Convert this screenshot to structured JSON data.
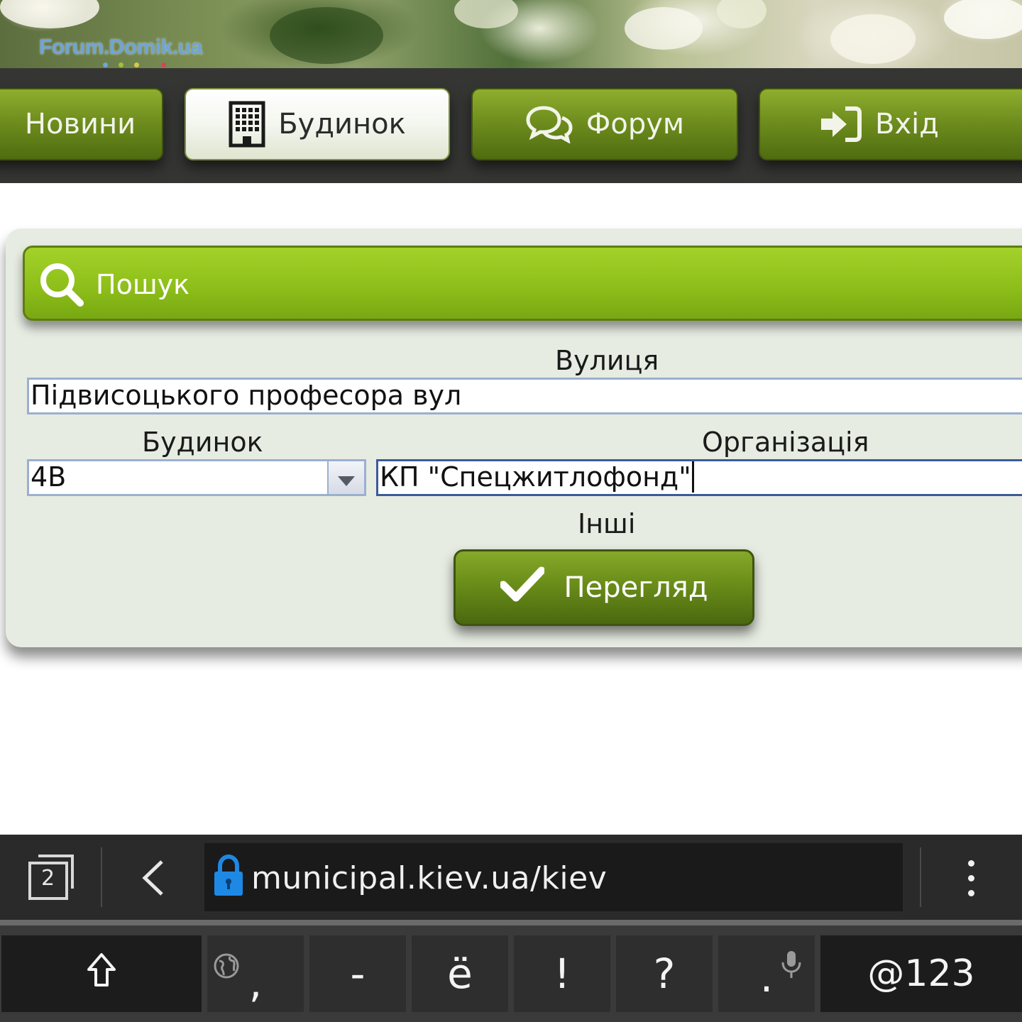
{
  "banner": {
    "logo_text": "Forum.Domik.ua"
  },
  "nav": {
    "items": [
      {
        "label": "Новини",
        "icon": "news-icon"
      },
      {
        "label": "Будинок",
        "icon": "building-icon",
        "active": true
      },
      {
        "label": "Форум",
        "icon": "chat-bubbles-icon"
      },
      {
        "label": "Вхід",
        "icon": "sign-in-icon"
      }
    ]
  },
  "search": {
    "title": "Пошук",
    "street_label": "Вулиця",
    "street_value": "Підвисоцького професора вул",
    "house_label": "Будинок",
    "house_value": "4В",
    "org_label": "Організація",
    "org_value": "КП \"Спецжитлофонд\"",
    "other_label": "Інші",
    "view_button": "Перегляд"
  },
  "browser": {
    "tab_count": "2",
    "url": "municipal.kiev.ua/kiev"
  },
  "keyboard": {
    "keys": [
      ",",
      "-",
      "ё",
      "!",
      "?",
      ".",
      "@123"
    ]
  },
  "colors": {
    "nav_green": "#6f8e1e",
    "search_header_green": "#8ebf1a",
    "panel_bg": "#e6ece2",
    "lock_blue": "#1e88e5"
  }
}
